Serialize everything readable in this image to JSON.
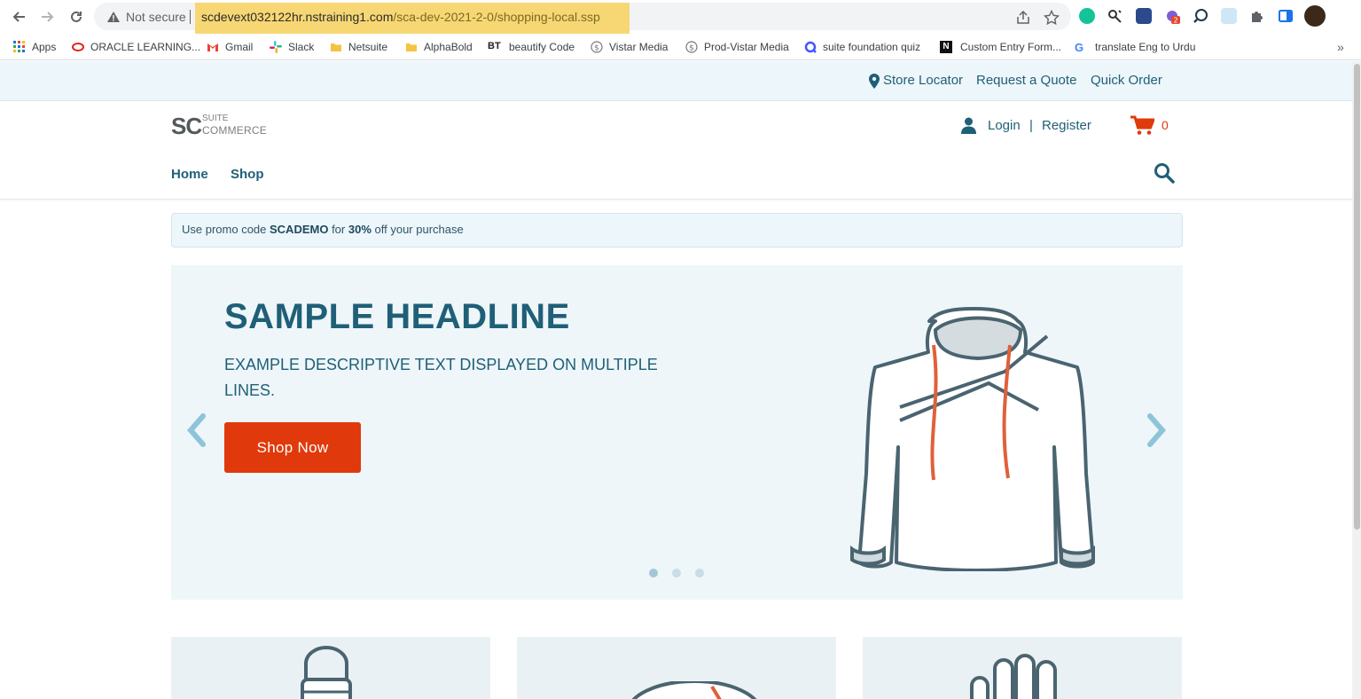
{
  "browser": {
    "security_label": "Not secure",
    "url_host": "scdevext032122hr.nstraining1.com",
    "url_path": "/sca-dev-2021-2-0/shopping-local.ssp",
    "bookmarks": [
      {
        "label": "Apps",
        "icon": "apps-grid-icon"
      },
      {
        "label": "ORACLE LEARNING...",
        "icon": "oracle-icon"
      },
      {
        "label": "Gmail",
        "icon": "gmail-icon"
      },
      {
        "label": "Slack",
        "icon": "slack-icon"
      },
      {
        "label": "Netsuite",
        "icon": "folder-icon"
      },
      {
        "label": "AlphaBold",
        "icon": "folder-icon"
      },
      {
        "label": "beautify Code",
        "icon": "bt-icon"
      },
      {
        "label": "Vistar Media",
        "icon": "dollar-circle-icon"
      },
      {
        "label": "Prod-Vistar Media",
        "icon": "dollar-circle-icon"
      },
      {
        "label": "suite foundation quiz",
        "icon": "quizlet-icon"
      },
      {
        "label": "Custom Entry Form...",
        "icon": "notion-icon"
      },
      {
        "label": "translate Eng to Urdu",
        "icon": "google-icon"
      }
    ],
    "extension_badge": "2"
  },
  "site": {
    "topbar": {
      "store_locator": "Store Locator",
      "request_quote": "Request a Quote",
      "quick_order": "Quick Order"
    },
    "logo": {
      "sc": "SC",
      "suite": "SUITE",
      "commerce": "COMMERCE"
    },
    "header": {
      "login": "Login",
      "divider": "|",
      "register": "Register",
      "cart_count": "0"
    },
    "nav": {
      "home": "Home",
      "shop": "Shop"
    },
    "promo": {
      "prefix": "Use promo code ",
      "code": "SCADEMO",
      "mid": " for ",
      "discount": "30%",
      "suffix": " off your purchase"
    },
    "banner": {
      "headline": "SAMPLE HEADLINE",
      "description": "EXAMPLE DESCRIPTIVE TEXT DISPLAYED ON MULTIPLE LINES.",
      "button": "Shop Now",
      "slide_count": 3,
      "active_slide": 1
    },
    "colors": {
      "brand": "#1f5f77",
      "accent": "#e0390b",
      "banner_bg": "#eef6f9"
    }
  }
}
